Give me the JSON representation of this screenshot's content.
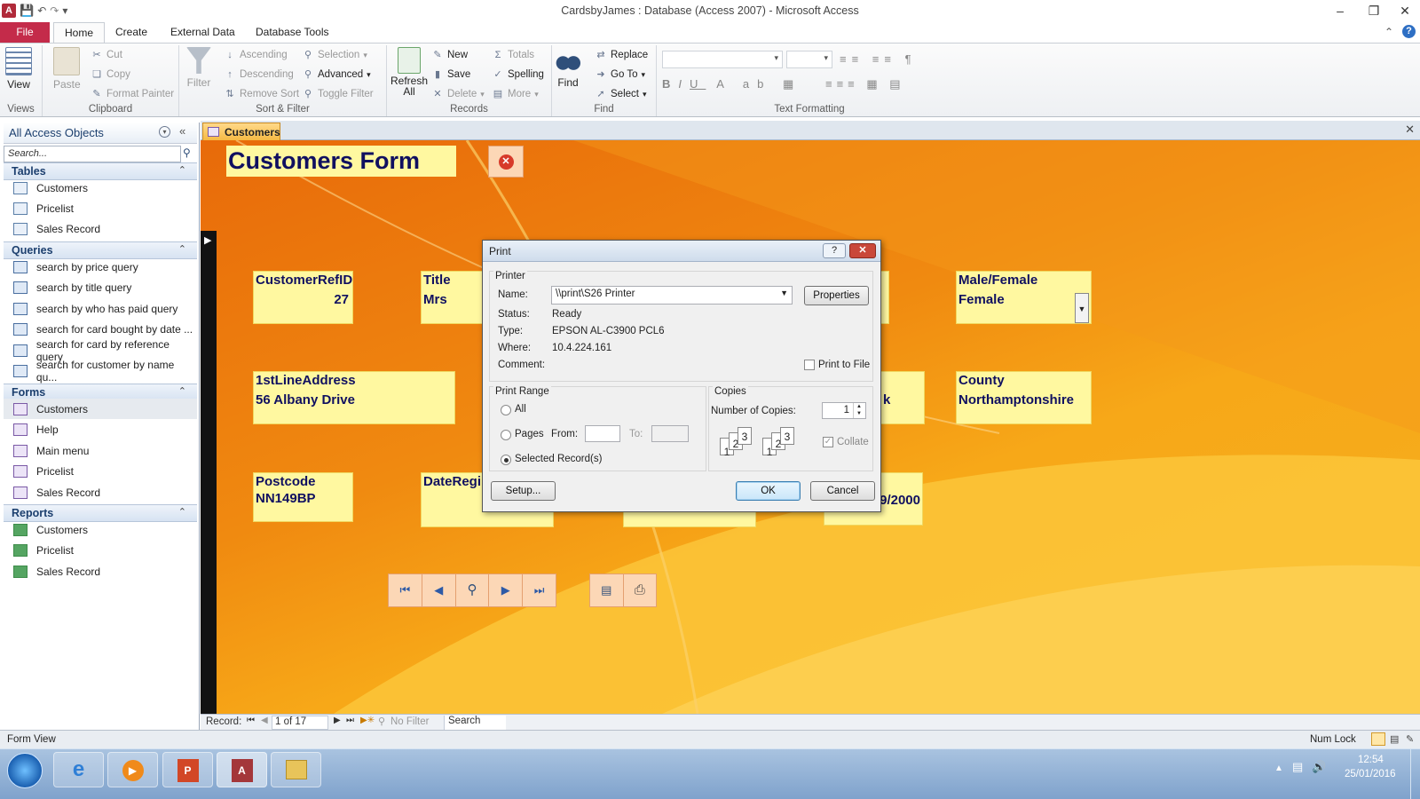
{
  "window": {
    "title": "CardsbyJames : Database (Access 2007) - Microsoft Access"
  },
  "ribbon": {
    "tabs": [
      "File",
      "Home",
      "Create",
      "External Data",
      "Database Tools"
    ],
    "groups": {
      "views": {
        "label": "Views",
        "view": "View"
      },
      "clipboard": {
        "label": "Clipboard",
        "paste": "Paste",
        "cut": "Cut",
        "copy": "Copy",
        "format_painter": "Format Painter"
      },
      "sort_filter": {
        "label": "Sort & Filter",
        "filter": "Filter",
        "ascending": "Ascending",
        "descending": "Descending",
        "remove_sort": "Remove Sort",
        "selection": "Selection",
        "advanced": "Advanced",
        "toggle_filter": "Toggle Filter"
      },
      "records": {
        "label": "Records",
        "refresh": "Refresh",
        "refresh_all": "All",
        "new": "New",
        "save": "Save",
        "delete": "Delete",
        "totals": "Totals",
        "spelling": "Spelling",
        "more": "More"
      },
      "find": {
        "label": "Find",
        "find": "Find",
        "replace": "Replace",
        "goto": "Go To",
        "select": "Select"
      },
      "text_formatting": {
        "label": "Text Formatting"
      }
    }
  },
  "nav": {
    "header": "All Access Objects",
    "search_placeholder": "Search...",
    "sections": {
      "tables": {
        "label": "Tables",
        "items": [
          "Customers",
          "Pricelist",
          "Sales Record"
        ]
      },
      "queries": {
        "label": "Queries",
        "items": [
          "search by price query",
          "search by title query",
          "search by who has paid query",
          "search for card bought by date ...",
          "search for card by reference query",
          "search for customer by name qu..."
        ]
      },
      "forms": {
        "label": "Forms",
        "items": [
          "Customers",
          "Help",
          "Main menu",
          "Pricelist",
          "Sales Record"
        ]
      },
      "reports": {
        "label": "Reports",
        "items": [
          "Customers",
          "Pricelist",
          "Sales Record"
        ]
      }
    }
  },
  "doc_tab": "Customers",
  "form": {
    "title": "Customers Form",
    "fields": {
      "ref": {
        "label": "CustomerRefID",
        "value": "27"
      },
      "title": {
        "label": "Title",
        "value": "Mrs"
      },
      "gender": {
        "label": "Male/Female",
        "value": "Female"
      },
      "address": {
        "label": "1stLineAddress",
        "value": "56 Albany Drive"
      },
      "town_partial": {
        "value": "k"
      },
      "county": {
        "label": "County",
        "value": "Northamptonshire"
      },
      "postcode": {
        "label": "Postcode",
        "value": "NN149BP"
      },
      "datereg": {
        "label": "DateRegi",
        "value": "9/2000"
      }
    }
  },
  "record_nav": {
    "label": "Record:",
    "position": "1 of 17",
    "filter": "No Filter",
    "search": "Search"
  },
  "status": {
    "left": "Form View",
    "num_lock": "Num Lock"
  },
  "dialog": {
    "title": "Print",
    "printer_group": "Printer",
    "name_label": "Name:",
    "name_value": "\\\\print\\S26 Printer",
    "properties": "Properties",
    "status_label": "Status:",
    "status_value": "Ready",
    "type_label": "Type:",
    "type_value": "EPSON AL-C3900 PCL6",
    "where_label": "Where:",
    "where_value": "10.4.224.161",
    "comment_label": "Comment:",
    "print_to_file": "Print to File",
    "range_group": "Print Range",
    "all": "All",
    "pages": "Pages",
    "from": "From:",
    "to": "To:",
    "selected": "Selected Record(s)",
    "copies_group": "Copies",
    "num_copies_label": "Number of Copies:",
    "num_copies": "1",
    "collate": "Collate",
    "setup": "Setup...",
    "ok": "OK",
    "cancel": "Cancel"
  },
  "taskbar": {
    "time": "12:54",
    "date": "25/01/2016"
  }
}
